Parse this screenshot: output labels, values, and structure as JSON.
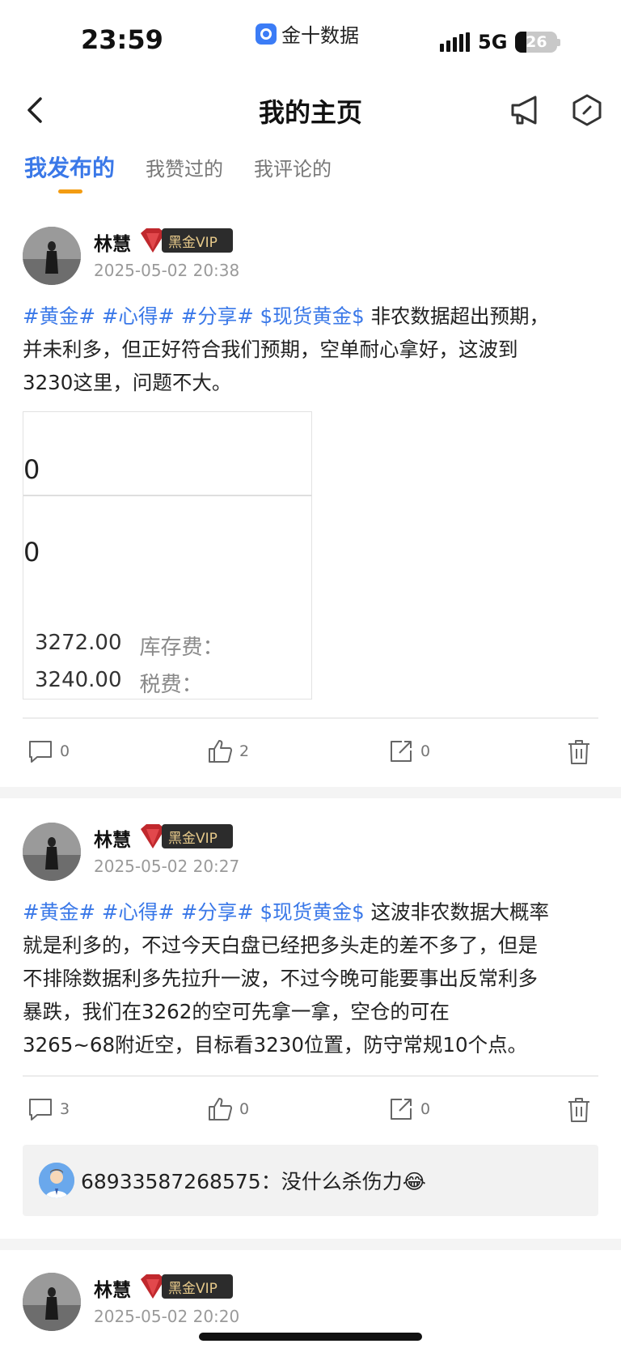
{
  "status_bar": {
    "time": "23:59",
    "app_name": "金十数据",
    "network": "5G",
    "battery_percent": "26",
    "battery_level": 0.26
  },
  "nav": {
    "title": "我的主页",
    "icons": [
      "back-icon",
      "megaphone-icon",
      "hexagon-settings-icon"
    ]
  },
  "tabs": [
    {
      "label": "我发布的",
      "active": true
    },
    {
      "label": "我赞过的",
      "active": false
    },
    {
      "label": "我评论的",
      "active": false
    }
  ],
  "colors": {
    "accent": "#3a78e8",
    "tab_underline": "#f39c12",
    "vip_text": "#e6c98a"
  },
  "posts": [
    {
      "author": "林慧",
      "vip_badge": "黑金VIP",
      "time": "2025-05-02 20:38",
      "tags": "#黄金# #心得# #分享# $现货黄金$",
      "body_lines": [
        " 非农数据超出预期，",
        "并未利多，但正好符合我们预期，空单耐心拿好，这波到",
        "3230这里，问题不大。"
      ],
      "image": {
        "zero_1": "0",
        "zero_2": "0",
        "row_1_value": "3272.00",
        "row_1_label": "库存费：",
        "row_2_value": "3240.00",
        "row_2_label": "税费："
      },
      "comments": "0",
      "likes": "2",
      "shares": "0"
    },
    {
      "author": "林慧",
      "vip_badge": "黑金VIP",
      "time": "2025-05-02 20:27",
      "tags": "#黄金# #心得# #分享# $现货黄金$",
      "body_lines": [
        " 这波非农数据大概率",
        "就是利多的，不过今天白盘已经把多头走的差不多了，但是",
        "不排除数据利多先拉升一波，不过今晚可能要事出反常利多",
        "暴跌，我们在3262的空可先拿一拿，空仓的可在",
        "3265~68附近空，目标看3230位置，防守常规10个点。"
      ],
      "comments": "3",
      "likes": "0",
      "shares": "0",
      "comment_preview": {
        "user": "68933587268575",
        "text": "：没什么杀伤力😂"
      }
    },
    {
      "author": "林慧",
      "vip_badge": "黑金VIP",
      "time": "2025-05-02 20:20"
    }
  ]
}
